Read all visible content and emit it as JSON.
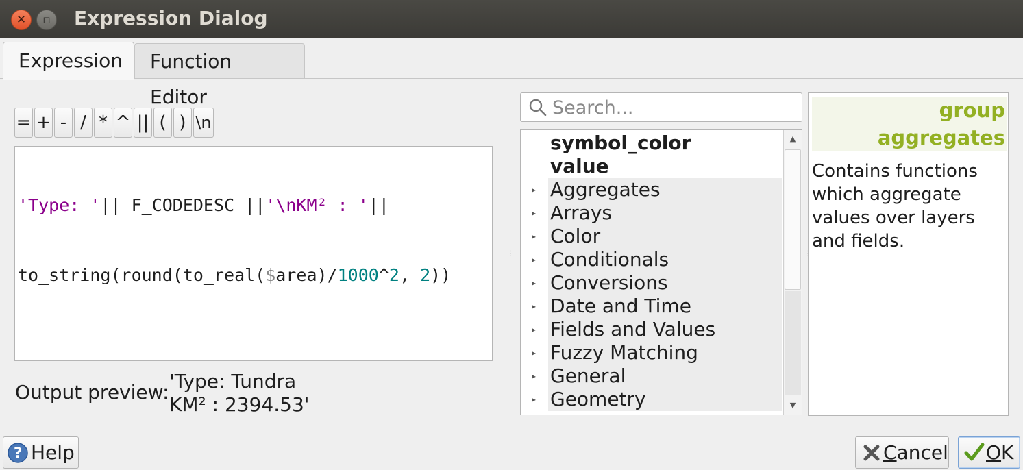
{
  "window": {
    "title": "Expression Dialog"
  },
  "tabs": [
    {
      "label": "Expression"
    },
    {
      "label": "Function Editor"
    }
  ],
  "operators": [
    "=",
    "+",
    "-",
    "/",
    "*",
    "^",
    "||",
    "(",
    ")",
    "\\n"
  ],
  "editor": {
    "line1": [
      {
        "t": "'Type: '",
        "c": "str"
      },
      {
        "t": "|| F_CODEDESC ||",
        "c": ""
      },
      {
        "t": "'\\nKM² : '",
        "c": "str"
      },
      {
        "t": "||",
        "c": ""
      }
    ],
    "line2": [
      {
        "t": "to_string(round(to_real(",
        "c": ""
      },
      {
        "t": "$",
        "c": "var"
      },
      {
        "t": "area)/",
        "c": ""
      },
      {
        "t": "1000",
        "c": "num"
      },
      {
        "t": "^",
        "c": ""
      },
      {
        "t": "2",
        "c": "num"
      },
      {
        "t": ", ",
        "c": ""
      },
      {
        "t": "2",
        "c": "num"
      },
      {
        "t": "))",
        "c": ""
      }
    ]
  },
  "preview": {
    "label": "Output preview:",
    "value_line1": "'Type: Tundra",
    "value_line2": "KM² : 2394.53'"
  },
  "search": {
    "placeholder": "Search..."
  },
  "tree": {
    "fields": [
      "symbol_color",
      "value"
    ],
    "groups": [
      "Aggregates",
      "Arrays",
      "Color",
      "Conditionals",
      "Conversions",
      "Date and Time",
      "Fields and Values",
      "Fuzzy Matching",
      "General",
      "Geometry"
    ]
  },
  "help_panel": {
    "heading_line1": "group",
    "heading_line2": "aggregates",
    "text": "Contains functions which aggregate values over layers and fields.",
    "heading_color": "#93b023"
  },
  "buttons": {
    "help": "Help",
    "cancel_mnemonic": "C",
    "cancel_rest": "ancel",
    "ok_mnemonic": "O",
    "ok_rest": "K"
  }
}
